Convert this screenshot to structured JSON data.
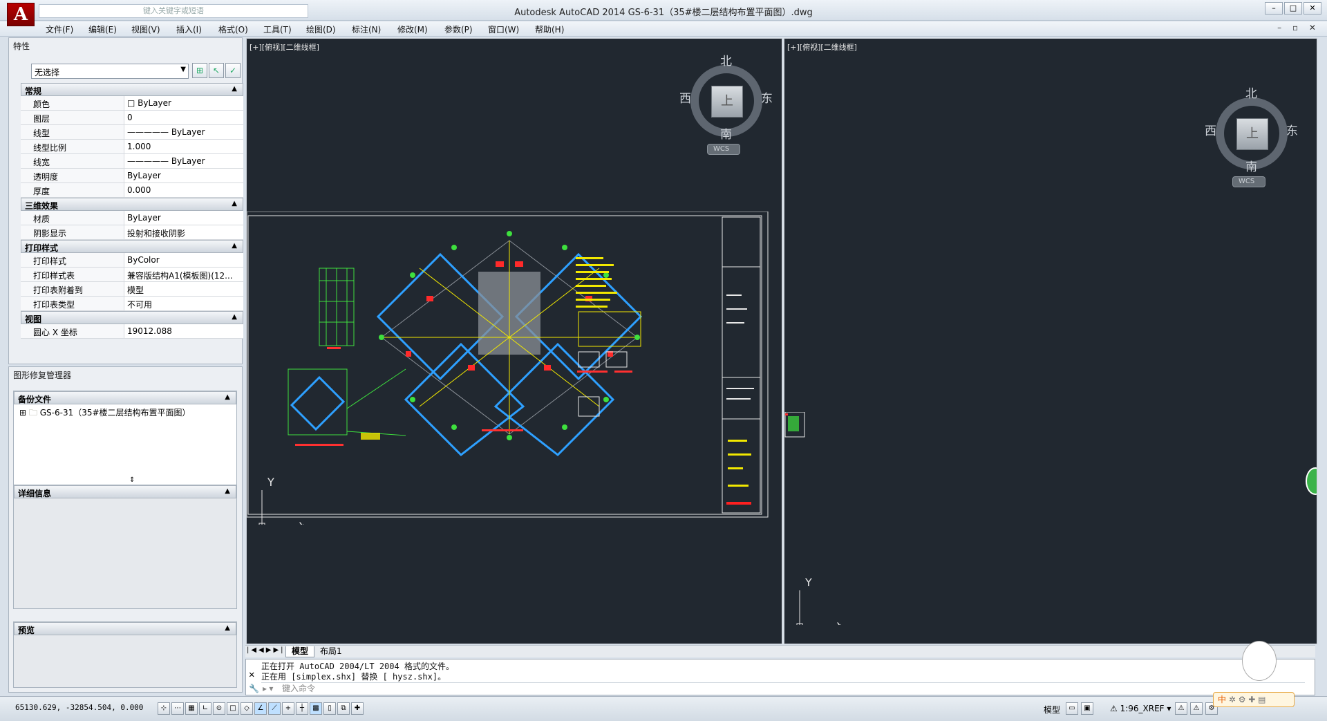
{
  "window": {
    "title": "Autodesk AutoCAD 2014    GS-6-31（35#楼二层结构布置平面图）.dwg",
    "search_placeholder": "键入关键字或短语",
    "controls": [
      "–",
      "□",
      "✕"
    ]
  },
  "menu": [
    "文件(F)",
    "编辑(E)",
    "视图(V)",
    "插入(I)",
    "格式(O)",
    "工具(T)",
    "绘图(D)",
    "标注(N)",
    "修改(M)",
    "参数(P)",
    "窗口(W)",
    "帮助(H)"
  ],
  "properties": {
    "title": "特性",
    "selection": "无选择",
    "sections": {
      "general": {
        "title": "常规",
        "rows": [
          {
            "k": "颜色",
            "v": "□ ByLayer"
          },
          {
            "k": "图层",
            "v": "0"
          },
          {
            "k": "线型",
            "v": "————— ByLayer"
          },
          {
            "k": "线型比例",
            "v": "1.000"
          },
          {
            "k": "线宽",
            "v": "————— ByLayer"
          },
          {
            "k": "透明度",
            "v": "ByLayer"
          },
          {
            "k": "厚度",
            "v": "0.000"
          }
        ]
      },
      "effects3d": {
        "title": "三维效果",
        "rows": [
          {
            "k": "材质",
            "v": "ByLayer"
          },
          {
            "k": "阴影显示",
            "v": "投射和接收阴影"
          }
        ]
      },
      "plotstyle": {
        "title": "打印样式",
        "rows": [
          {
            "k": "打印样式",
            "v": "ByColor"
          },
          {
            "k": "打印样式表",
            "v": "兼容版结构A1(模板图)(12..."
          },
          {
            "k": "打印表附着到",
            "v": "模型"
          },
          {
            "k": "打印表类型",
            "v": "不可用"
          }
        ]
      },
      "view": {
        "title": "视图",
        "rows": [
          {
            "k": "圆心 X 坐标",
            "v": "19012.088"
          }
        ]
      }
    }
  },
  "recovery": {
    "title": "图形修复管理器",
    "backup_title": "备份文件",
    "backup_item": "GS-6-31（35#楼二层结构布置平面图）",
    "details_title": "详细信息",
    "preview_title": "预览"
  },
  "viewports": {
    "left_label": "[+][俯视][二维线框]",
    "right_label": "[+][俯视][二维线框]",
    "compass": {
      "n": "北",
      "s": "南",
      "e": "东",
      "w": "西",
      "face": "上",
      "wcs": "WCS"
    },
    "ucs": {
      "x": "X",
      "y": "Y"
    }
  },
  "tabs": [
    "模型",
    "布局1"
  ],
  "command": {
    "history": [
      "正在打开 AutoCAD 2004/LT 2004 格式的文件。",
      "正在用 [simplex.shx] 替换 [ hysz.shx]。"
    ],
    "placeholder": "键入命令"
  },
  "status": {
    "coords": "65130.629, -32854.504, 0.000",
    "model_label": "模型",
    "scale": "1:96_XREF"
  },
  "ime": {
    "label": "中"
  }
}
